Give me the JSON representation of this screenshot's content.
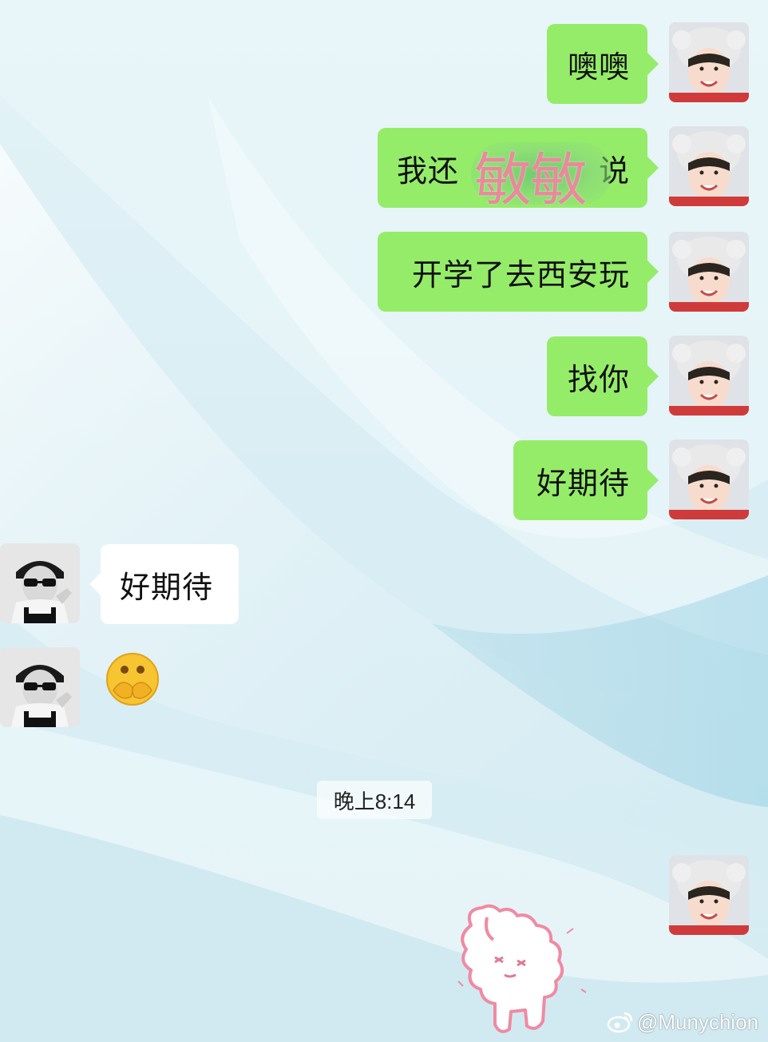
{
  "chat": {
    "sent_messages": [
      {
        "text": "噢噢"
      },
      {
        "text_visible": "我还",
        "text_visible_end": "说"
      },
      {
        "text": "开学了去西安玩"
      },
      {
        "text": "找你"
      },
      {
        "text": "好期待"
      }
    ],
    "censor_overlay": "敏敏",
    "received_messages": [
      {
        "text": "好期待"
      }
    ],
    "timestamp": "晚上8:14"
  },
  "watermark": {
    "handle": "@Munychion"
  },
  "colors": {
    "sent_bubble": "#95ec69",
    "received_bubble": "#ffffff",
    "censor_text": "#e98a9c",
    "background": "#d9eef4"
  },
  "icons": {
    "sent_avatar": "girl-white-hat-avatar",
    "received_avatar": "boy-sunglasses-avatar",
    "emoji": "facepalm-emoji",
    "sticker": "pink-fluffy-creature-sticker",
    "watermark_logo": "weibo-icon"
  }
}
